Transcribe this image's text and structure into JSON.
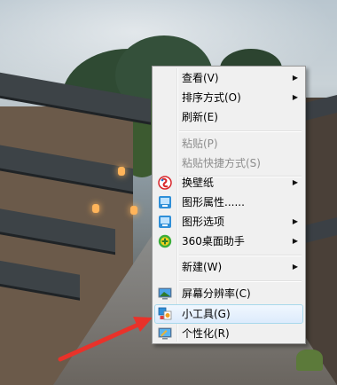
{
  "context_menu": {
    "items": [
      {
        "label": "查看(V)",
        "submenu": true
      },
      {
        "label": "排序方式(O)",
        "submenu": true
      },
      {
        "label": "刷新(E)",
        "submenu": false
      },
      {
        "label": "粘贴(P)",
        "disabled": true
      },
      {
        "label": "粘贴快捷方式(S)",
        "disabled": true
      },
      {
        "label": "换壁纸",
        "icon": "wallpaper-change-icon",
        "submenu": true
      },
      {
        "label": "图形属性......",
        "icon": "graphics-properties-icon"
      },
      {
        "label": "图形选项",
        "icon": "graphics-options-icon",
        "submenu": true
      },
      {
        "label": "360桌面助手",
        "icon": "360-desktop-assistant-icon",
        "submenu": true
      },
      {
        "label": "新建(W)",
        "submenu": true
      },
      {
        "label": "屏幕分辨率(C)",
        "icon": "screen-resolution-icon"
      },
      {
        "label": "小工具(G)",
        "icon": "gadgets-icon",
        "highlighted": true
      },
      {
        "label": "个性化(R)",
        "icon": "personalize-icon"
      }
    ],
    "submenu_arrow": "▶"
  },
  "colors": {
    "menu_background": "#f0f0f0",
    "menu_border": "#979797",
    "highlight_border": "#a8d8eb",
    "disabled_text": "#8d8d8d",
    "annotation_arrow": "#e8322a"
  }
}
